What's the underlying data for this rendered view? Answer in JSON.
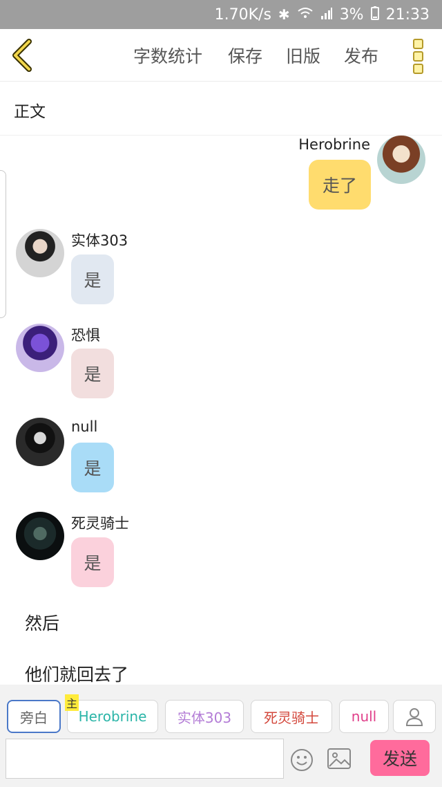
{
  "status_bar": {
    "net_speed": "1.70K/s",
    "battery": "3%",
    "time": "21:33",
    "icons": [
      "bluetooth-icon",
      "wifi-icon",
      "signal-icon",
      "battery-icon"
    ]
  },
  "toolbar": {
    "word_count": "字数统计",
    "save": "保存",
    "old_version": "旧版",
    "publish": "发布"
  },
  "section": {
    "title": "正文"
  },
  "messages": [
    {
      "name": "Herobrine",
      "text": "走了",
      "side": "right",
      "bubble_color": "#ffdc6e"
    },
    {
      "name": "实体303",
      "text": "是",
      "side": "left",
      "bubble_color": "#e1e8f1"
    },
    {
      "name": "恐惧",
      "text": "是",
      "side": "left",
      "bubble_color": "#f2dede"
    },
    {
      "name": "null",
      "text": "是",
      "side": "left",
      "bubble_color": "#a9dcf7"
    },
    {
      "name": "死灵骑士",
      "text": "是",
      "side": "left",
      "bubble_color": "#fbd1dc"
    }
  ],
  "narration": [
    "然后",
    "他们就回去了"
  ],
  "roles": [
    {
      "label": "旁白",
      "color": "#666666",
      "active": true
    },
    {
      "label": "Herobrine",
      "color": "#2bb5a8",
      "badge": "主"
    },
    {
      "label": "实体303",
      "color": "#b37cd6"
    },
    {
      "label": "死灵骑士",
      "color": "#d3473b"
    },
    {
      "label": "null",
      "color": "#e0408a"
    }
  ],
  "composer": {
    "placeholder": "",
    "send": "发送"
  },
  "accent": "#ffdc6e"
}
